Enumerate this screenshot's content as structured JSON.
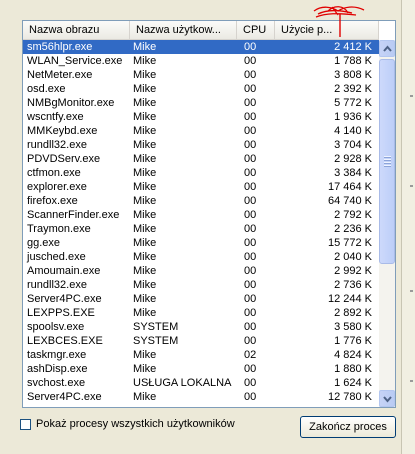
{
  "columns": [
    "Nazwa obrazu",
    "Nazwa użytkow...",
    "CPU",
    "Użycie p..."
  ],
  "processes": [
    {
      "name": "sm56hlpr.exe",
      "user": "Mike",
      "cpu": "00",
      "mem": "2 412 K"
    },
    {
      "name": "WLAN_Service.exe",
      "user": "Mike",
      "cpu": "00",
      "mem": "1 788 K"
    },
    {
      "name": "NetMeter.exe",
      "user": "Mike",
      "cpu": "00",
      "mem": "3 808 K"
    },
    {
      "name": "osd.exe",
      "user": "Mike",
      "cpu": "00",
      "mem": "2 392 K"
    },
    {
      "name": "NMBgMonitor.exe",
      "user": "Mike",
      "cpu": "00",
      "mem": "5 772 K"
    },
    {
      "name": "wscntfy.exe",
      "user": "Mike",
      "cpu": "00",
      "mem": "1 936 K"
    },
    {
      "name": "MMKeybd.exe",
      "user": "Mike",
      "cpu": "00",
      "mem": "4 140 K"
    },
    {
      "name": "rundll32.exe",
      "user": "Mike",
      "cpu": "00",
      "mem": "3 704 K"
    },
    {
      "name": "PDVDServ.exe",
      "user": "Mike",
      "cpu": "00",
      "mem": "2 928 K"
    },
    {
      "name": "ctfmon.exe",
      "user": "Mike",
      "cpu": "00",
      "mem": "3 384 K"
    },
    {
      "name": "explorer.exe",
      "user": "Mike",
      "cpu": "00",
      "mem": "17 464 K"
    },
    {
      "name": "firefox.exe",
      "user": "Mike",
      "cpu": "00",
      "mem": "64 740 K"
    },
    {
      "name": "ScannerFinder.exe",
      "user": "Mike",
      "cpu": "00",
      "mem": "2 792 K"
    },
    {
      "name": "Traymon.exe",
      "user": "Mike",
      "cpu": "00",
      "mem": "2 236 K"
    },
    {
      "name": "gg.exe",
      "user": "Mike",
      "cpu": "00",
      "mem": "15 772 K"
    },
    {
      "name": "jusched.exe",
      "user": "Mike",
      "cpu": "00",
      "mem": "2 040 K"
    },
    {
      "name": "Amoumain.exe",
      "user": "Mike",
      "cpu": "00",
      "mem": "2 992 K"
    },
    {
      "name": "rundll32.exe",
      "user": "Mike",
      "cpu": "00",
      "mem": "2 736 K"
    },
    {
      "name": "Server4PC.exe",
      "user": "Mike",
      "cpu": "00",
      "mem": "12 244 K"
    },
    {
      "name": "LEXPPS.EXE",
      "user": "Mike",
      "cpu": "00",
      "mem": "2 892 K"
    },
    {
      "name": "spoolsv.exe",
      "user": "SYSTEM",
      "cpu": "00",
      "mem": "3 580 K"
    },
    {
      "name": "LEXBCES.EXE",
      "user": "SYSTEM",
      "cpu": "00",
      "mem": "1 776 K"
    },
    {
      "name": "taskmgr.exe",
      "user": "Mike",
      "cpu": "02",
      "mem": "4 824 K"
    },
    {
      "name": "ashDisp.exe",
      "user": "Mike",
      "cpu": "00",
      "mem": "1 880 K"
    },
    {
      "name": "svchost.exe",
      "user": "USŁUGA LOKALNA",
      "cpu": "00",
      "mem": "1 624 K"
    },
    {
      "name": "Server4PC.exe",
      "user": "Mike",
      "cpu": "00",
      "mem": "12 780 K"
    }
  ],
  "selected_row": 0,
  "show_all_label": "Pokaż procesy wszystkich użytkowników",
  "show_all_checked": false,
  "end_process_label": "Zakończ proces",
  "colors": {
    "selection": "#316ac5",
    "annotation": "#e00000",
    "window_bg": "#ece9d8"
  }
}
